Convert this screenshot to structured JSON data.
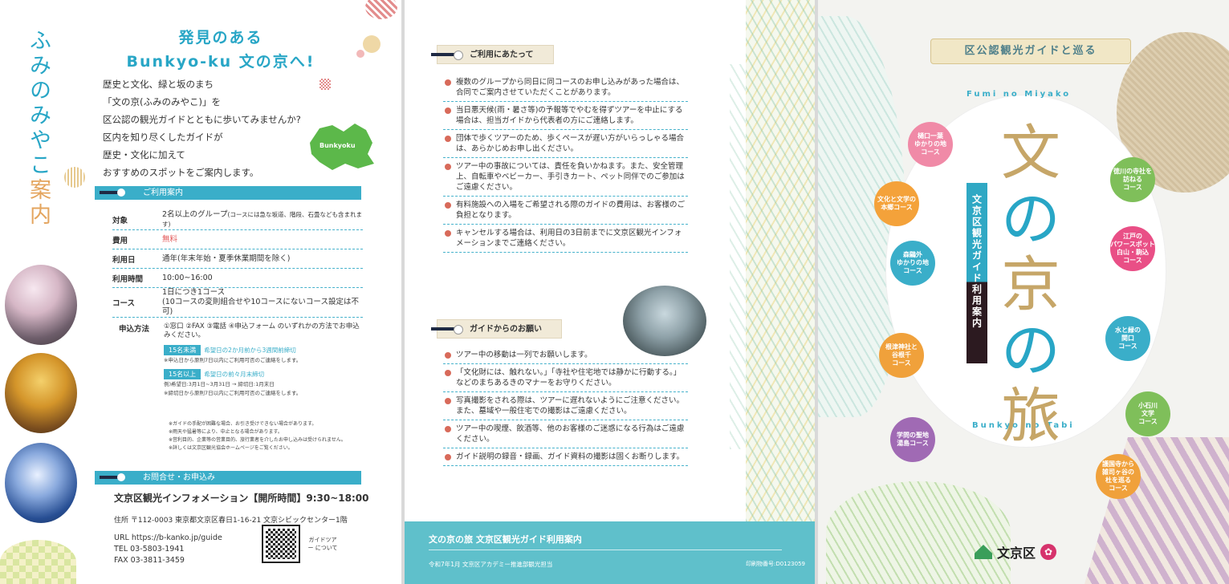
{
  "left": {
    "vertical_title_a": "ふみのみやこ",
    "vertical_title_b": "案内",
    "heading1": "発見のある",
    "heading2": "Bunkyo-ku 文の京へ!",
    "intro": [
      "歴史と文化、緑と坂のまち",
      "「文の京(ふみのみやこ)」を",
      "区公認の観光ガイドとともに歩いてみませんか?",
      "区内を知り尽くしたガイドが",
      "歴史・文化に加えて",
      "おすすめのスポットをご案内します。"
    ],
    "map_label": "Bunkyoku",
    "usage_header": "ご利用案内",
    "usage": [
      {
        "k": "対象",
        "v": "2名以上のグループ",
        "note": "(コースには急な坂道、階段、石畳なども含まれます)"
      },
      {
        "k": "費用",
        "v": "無料",
        "note": ""
      },
      {
        "k": "利用日",
        "v": "通年(年末年始・夏季休業期間を除く)",
        "note": ""
      },
      {
        "k": "利用時間",
        "v": "10:00~16:00",
        "note": ""
      },
      {
        "k": "コース",
        "v": "1日につき1コース",
        "note": "(10コースの変則組合せや10コースにないコース設定は不可)"
      }
    ],
    "apply_key": "申込方法",
    "apply_text": "①窓口 ②FAX ③電話 ④申込フォーム のいずれかの方法でお申込みください。",
    "apply_rows": [
      {
        "badge": "15名未満",
        "text": "希望日の2か月前から3週間前締切",
        "sub": "※申込日から原則7日以内にご利用可否のご連絡をします。"
      },
      {
        "badge": "15名以上",
        "text": "希望日の前々月末締切",
        "sub": "例)希望日:3月1日~3月31日 → 締切日:1月末日"
      }
    ],
    "apply_sub2": "※締切日から原則7日以内にご利用可否のご連絡をします。",
    "notes": [
      "※ガイドの手配が困難な場合、お引き受けできない場合があります。",
      "※雨天や猛暑等により、中止となる場合があります。",
      "※営利目的、企業等の営業目的、旅行業者を介したお申し込みは受けられません。",
      "※詳しくは文京区観光協会ホームページをご覧ください。"
    ],
    "contact_header": "お問合せ・お申込み",
    "contact_title": "文京区観光インフォメーション【開所時間】9:30~18:00",
    "address": "住所  〒112-0003 東京都文京区春日1-16-21 文京シビックセンター1階",
    "url": "URL   https://b-kanko.jp/guide",
    "tel": "TEL   03-5803-1941",
    "fax": "FAX   03-3811-3459",
    "qr_label": "ガイドツアー について"
  },
  "middle": {
    "section1_title": "ご利用にあたって",
    "section1_items": [
      "複数のグループから同日に同コースのお申し込みがあった場合は、合同でご案内させていただくことがあります。",
      "当日悪天候(雨・暑さ等)の予報等でやむを得ずツアーを中止にする場合は、担当ガイドから代表者の方にご連絡します。",
      "団体で歩くツアーのため、歩くペースが遅い方がいらっしゃる場合は、あらかじめお申し出ください。",
      "ツアー中の事故については、責任を負いかねます。また、安全管理上、自転車やベビーカー、手引きカート、ペット同伴でのご参加はご遠慮ください。",
      "有料施設への入場をご希望される際のガイドの費用は、お客様のご負担となります。",
      "キャンセルする場合は、利用日の3日前までに文京区観光インフォメーションまでご連絡ください。"
    ],
    "section2_title": "ガイドからのお願い",
    "section2_items": [
      "ツアー中の移動は一列でお願いします。",
      "「文化財には、触れない。」「寺社や住宅地では静かに行動する。」などのまちあるきのマナーをお守りください。",
      "写真撮影をされる際は、ツアーに遅れないようにご注意ください。また、墓域や一般住宅での撮影はご遠慮ください。",
      "ツアー中の喫煙、飲酒等、他のお客様のご迷惑になる行為はご遠慮ください。",
      "ガイド説明の録音・録画、ガイド資料の撮影は固くお断りします。"
    ],
    "footer_title": "文の京の旅 文京区観光ガイド利用案内",
    "footer_date": "令和7年1月  文京区アカデミー推進部観光担当",
    "footer_code": "印刷物番号:D0123059"
  },
  "right": {
    "ribbon": "区公認観光ガイドと巡る",
    "fumi_en": "Fumi no Miyako",
    "bunkyo_en": "Bunkyo no Tabi",
    "title_chars": [
      "文",
      "の",
      "京",
      "の",
      "旅"
    ],
    "banner": "文京区観光ガイド利用案内",
    "courses": [
      {
        "label": "樋口一葉\nゆかりの地\nコース",
        "color": "#f08aa7"
      },
      {
        "label": "文化と文学の\n本郷コース",
        "color": "#f4a23a"
      },
      {
        "label": "森鷗外\nゆかりの地\nコース",
        "color": "#3aaec9"
      },
      {
        "label": "根津神社と\n谷根千\nコース",
        "color": "#f0a13b"
      },
      {
        "label": "学問の聖地\n湯島コース",
        "color": "#a06ab4"
      },
      {
        "label": "徳川の寺社を\n訪ねる\nコース",
        "color": "#7fbf5a"
      },
      {
        "label": "江戸の\nパワースポット\n白山・駒込\nコース",
        "color": "#e94f86"
      },
      {
        "label": "水と緑の\n関口\nコース",
        "color": "#3aaec9"
      },
      {
        "label": "小石川\n文学\nコース",
        "color": "#7fbf5a"
      },
      {
        "label": "護国寺から\n雑司ヶ谷の\n杜を巡る\nコース",
        "color": "#f0a13b"
      }
    ],
    "logo_text": "文京区"
  }
}
